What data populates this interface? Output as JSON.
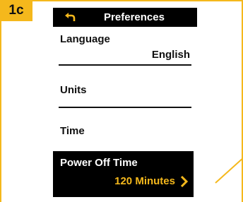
{
  "step_label": "1c",
  "header": {
    "title": "Preferences"
  },
  "items": [
    {
      "label": "Language",
      "value": "English"
    },
    {
      "label": "Units"
    },
    {
      "label": "Time"
    }
  ],
  "selected": {
    "label": "Power Off Time",
    "value": "120 Minutes"
  },
  "colors": {
    "accent": "#f5b81c",
    "screen_bg": "#000000",
    "text": "#111111"
  },
  "icons": {
    "back": "back-arrow-icon",
    "next": "chevron-right-icon"
  }
}
